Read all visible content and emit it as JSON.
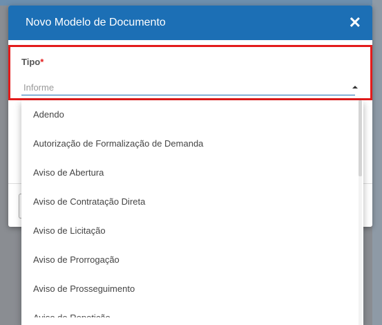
{
  "dialog": {
    "title": "Novo Modelo de Documento",
    "close_label": "✕"
  },
  "field": {
    "label": "Tipo",
    "required_marker": "*",
    "placeholder": "Informe",
    "value": ""
  },
  "dropdown": {
    "options": [
      "Adendo",
      "Autorização de Formalização de Demanda",
      "Aviso de Abertura",
      "Aviso de Contratação Direta",
      "Aviso de Licitação",
      "Aviso de Prorrogação",
      "Aviso de Prosseguimento",
      "Aviso de Repetição"
    ]
  },
  "colors": {
    "header": "#1c6fb5",
    "highlight_border": "#e31b1b"
  }
}
